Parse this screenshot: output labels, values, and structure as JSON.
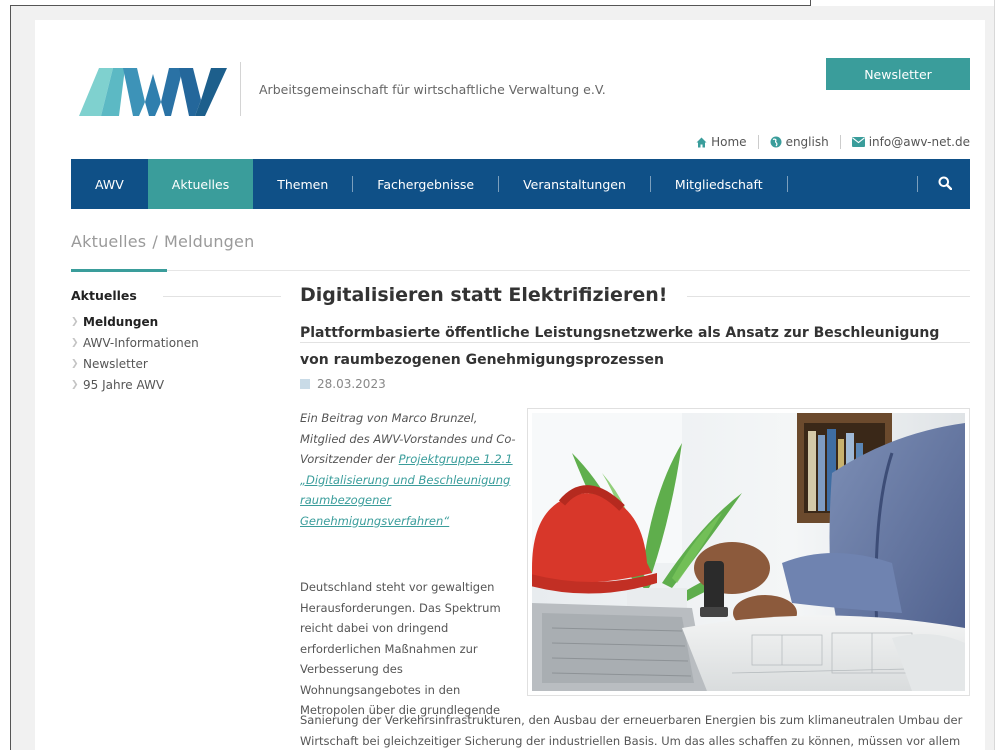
{
  "header": {
    "logo_text": "AWV",
    "org_name": "Arbeitsgemeinschaft für wirtschaftliche Verwaltung e.V.",
    "newsletter_button": "Newsletter"
  },
  "util_nav": {
    "home": "Home",
    "english": "english",
    "email": "info@awv-net.de"
  },
  "nav": {
    "items": [
      "AWV",
      "Aktuelles",
      "Themen",
      "Fachergebnisse",
      "Veranstaltungen",
      "Mitgliedschaft"
    ],
    "active": "Aktuelles",
    "search_icon": "search-icon"
  },
  "breadcrumb": {
    "parent": "Aktuelles",
    "separator": "/",
    "current": "Meldungen"
  },
  "sidebar": {
    "title": "Aktuelles",
    "items": [
      "Meldungen",
      "AWV-Informationen",
      "Newsletter",
      "95 Jahre AWV"
    ],
    "active": "Meldungen"
  },
  "article": {
    "title": "Digitalisieren statt Elektrifizieren!",
    "subtitle": "Plattformbasierte öffentliche Leistungsnetzwerke als Ansatz zur Beschleunigung von raumbezogenen Genehmigungsprozessen",
    "date": "28.03.2023",
    "intro_text": "Ein Beitrag von Marco Brunzel, Mitglied des AWV-Vorstandes und Co-Vorsitzender der",
    "intro_link": "Projektgruppe 1.2.1 „Digitalisierung und Beschleunigung raumbezogener Genehmigungsverfahren“",
    "body_narrow": "Deutschland steht vor gewaltigen Herausforderungen. Das Spektrum reicht dabei von dringend erforderlichen Maßnahmen zur Verbesserung des Wohnungsangebotes in den Metropolen über die grundlegende",
    "body_wide": "Sanierung der Verkehrsinfrastrukturen, den Ausbau der erneuerbaren Energien bis zum klimaneutralen Umbau der Wirtschaft bei gleichzeitiger Sicherung der industriellen Basis. Um das alles schaffen zu können, müssen vor allem"
  },
  "colors": {
    "nav_blue": "#0f5087",
    "teal": "#3a9d9b",
    "logo_light": "#7fd1cf",
    "logo_dark": "#1d5f8c"
  }
}
